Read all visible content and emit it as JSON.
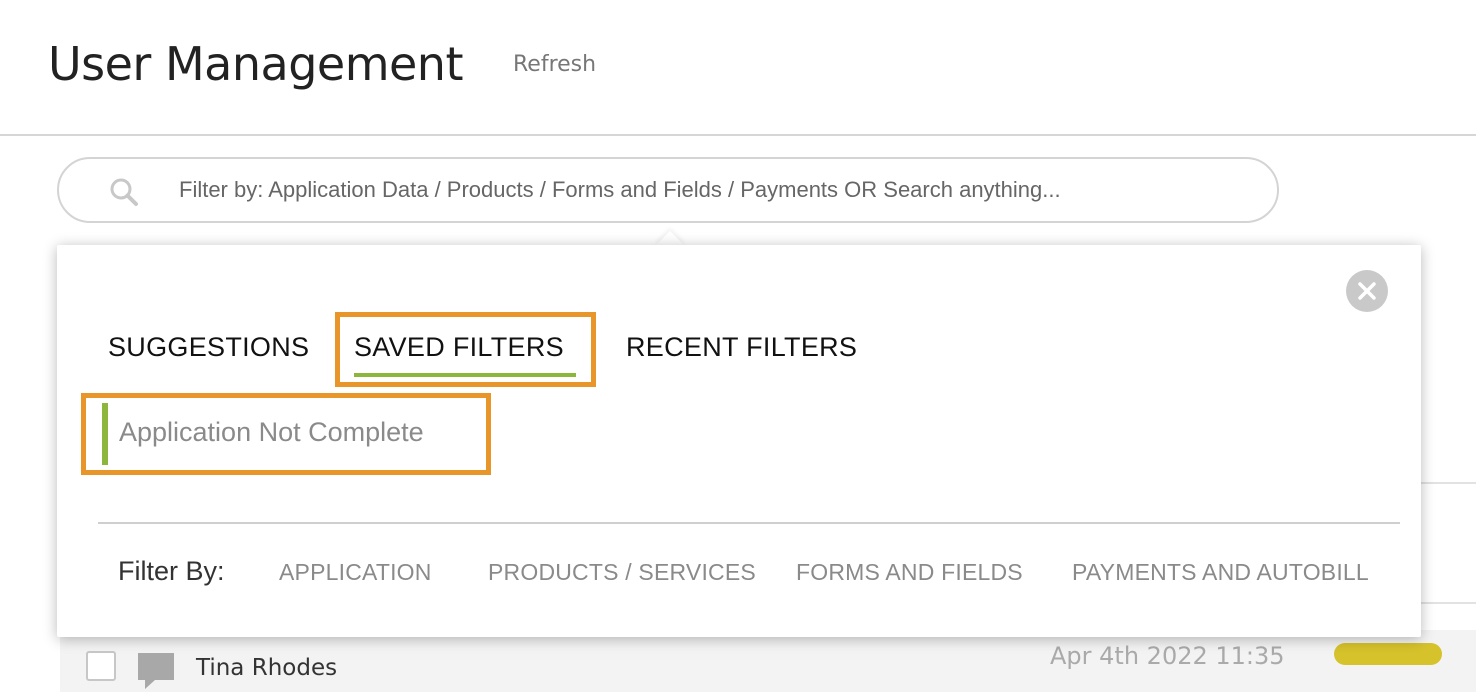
{
  "header": {
    "title": "User Management",
    "refresh_label": "Refresh"
  },
  "search": {
    "placeholder": "Filter by: Application Data / Products / Forms and Fields / Payments OR Search anything...",
    "icon": "search-icon"
  },
  "filter_panel": {
    "close_icon": "close-icon",
    "tabs": [
      {
        "label": "SUGGESTIONS",
        "active": false
      },
      {
        "label": "SAVED FILTERS",
        "active": true
      },
      {
        "label": "RECENT FILTERS",
        "active": false
      }
    ],
    "saved_filters": [
      {
        "label": "Application Not Complete"
      }
    ],
    "filter_by_label": "Filter By:",
    "categories": [
      {
        "label": "APPLICATION"
      },
      {
        "label": "PRODUCTS / SERVICES"
      },
      {
        "label": "FORMS AND FIELDS"
      },
      {
        "label": "PAYMENTS AND AUTOBILL"
      }
    ],
    "highlight_color": "#e8962a",
    "active_accent_color": "#8cb63c"
  },
  "user_list": {
    "rows": [
      {
        "name": "Tina Rhodes",
        "date": "Apr 4th 2022 11:35",
        "status_color": "#d6c22b"
      }
    ]
  }
}
